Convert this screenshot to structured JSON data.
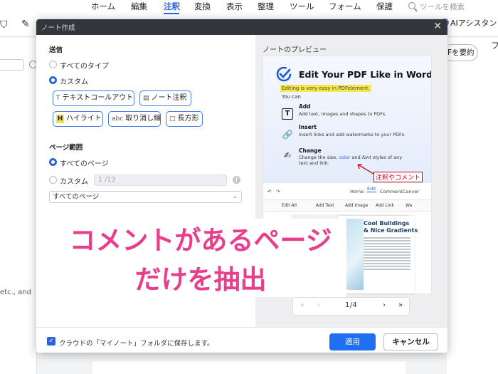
{
  "menubar": {
    "items": [
      "ホーム",
      "編集",
      "注釈",
      "変換",
      "表示",
      "整理",
      "ツール",
      "フォーム",
      "保護"
    ],
    "active_index": 2,
    "search_placeholder": "ツールを検索"
  },
  "toolbar": {
    "ai_label": "AIアシスタン",
    "summary_label": "Fを要約",
    "right_char": "フ"
  },
  "background": {
    "left_text": "etc., and"
  },
  "dialog": {
    "title": "ノート作成",
    "close_glyph": "✕",
    "send": {
      "label": "送信",
      "options": [
        "すべてのタイプ",
        "カスタム"
      ],
      "selected_index": 1,
      "types": [
        "テキストコールアウト",
        "ノート注釈",
        "ハイライト",
        "取り消し線",
        "長方形"
      ],
      "type_icons": [
        "T",
        "▤",
        "H",
        "abc",
        "□"
      ]
    },
    "page_range": {
      "label": "ページ範囲",
      "options": [
        "すべてのページ",
        "カスタム"
      ],
      "selected_index": 0,
      "custom_placeholder": "1 /13",
      "select_value": "すべてのページ"
    },
    "preview": {
      "title": "ノートのプレビュー",
      "card_heading": "Edit Your PDF Like in Word",
      "card_highlight": "Editing is very easy in PDFelement.",
      "card_youcan": "You can",
      "features": [
        {
          "title": "Add",
          "desc": "Add text, images and shapes to PDFs."
        },
        {
          "title": "Insert",
          "desc": "Insert links and add watermarks to your PDFs."
        },
        {
          "title": "Change",
          "desc_parts": [
            "Change the ",
            "size",
            ", ",
            "color",
            " and ",
            "font styles",
            " of any"
          ],
          "desc2": "text and link."
        }
      ],
      "annotation": "注釈やコメント",
      "tabs": [
        "Home",
        "Edit",
        "Comment",
        "Conver"
      ],
      "tools": [
        "Edit All",
        "Add Text",
        "Add Image",
        "Add Link",
        "Wa"
      ],
      "doc_title_1": "Cool Buildings",
      "doc_title_2": "& Nice Gradients",
      "pager": {
        "first": "«",
        "prev": "‹",
        "page": "1",
        "total": "/4",
        "next": "›",
        "last": "»"
      }
    },
    "caption": {
      "line1": "コメントがあるページ",
      "line2": "だけを抽出"
    },
    "footer": {
      "checkbox_label": "クラウドの「マイノート」フォルダに保存します。",
      "checked": true,
      "apply": "適用",
      "cancel": "キャンセル"
    }
  },
  "colors": {
    "accent": "#2b66d9",
    "caption_pink": "#e83e8c",
    "annotation_red": "#d0021b"
  }
}
